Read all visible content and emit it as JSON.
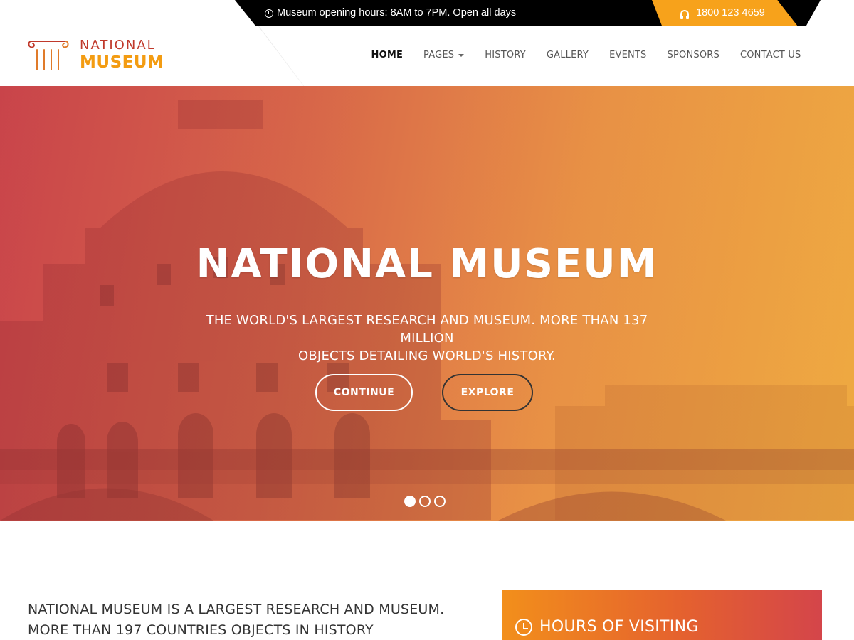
{
  "topbar": {
    "info_icon": "clock-icon",
    "info_text": "Museum opening hours: 8AM to 7PM. Open all days",
    "phone_icon": "headset-icon",
    "phone": "1800 123 4659"
  },
  "logo": {
    "line1": "NATIONAL",
    "line2": "MUSEUM"
  },
  "nav": {
    "home": "HOME",
    "pages": "PAGES",
    "history": "HISTORY",
    "gallery": "GALLERY",
    "events": "EVENTS",
    "sponsors": "SPONSORS",
    "contact": "CONTACT US"
  },
  "hero": {
    "title": "NATIONAL MUSEUM",
    "subtitle_line1": "THE WORLD'S LARGEST RESEARCH AND MUSEUM. MORE THAN 137 MILLION",
    "subtitle_line2": "OBJECTS DETAILING WORLD'S HISTORY.",
    "continue_label": "CONTINUE",
    "explore_label": "EXPLORE",
    "slide_count": 3,
    "active_slide": 1
  },
  "about": {
    "line1": "NATIONAL MUSEUM IS A LARGEST RESEARCH AND MUSEUM.",
    "line2": "MORE THAN 197 COUNTRIES OBJECTS IN HISTORY"
  },
  "hours": {
    "icon": "clock-icon",
    "title": "HOURS OF VISITING"
  },
  "colors": {
    "accent_orange": "#f7a21b",
    "accent_red": "#c0392b",
    "topbar_bg": "#000000"
  }
}
